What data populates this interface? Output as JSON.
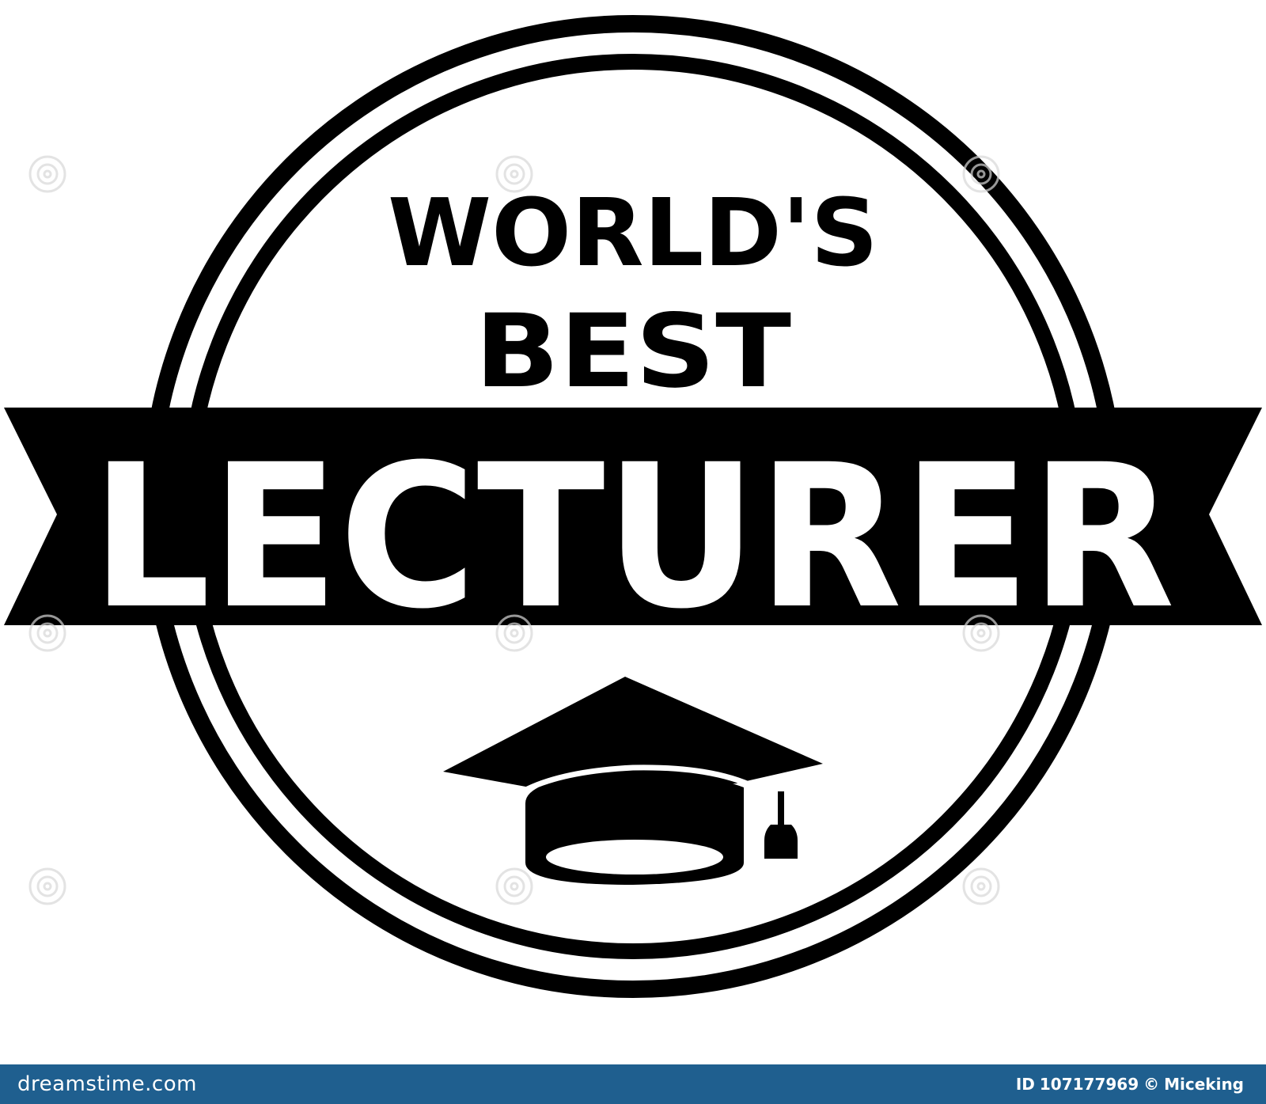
{
  "badge": {
    "line1": "WORLD'S",
    "line2": "BEST",
    "banner_text": "LECTURER",
    "icon": "graduation-cap-icon",
    "ink_color": "#000000",
    "background_color": "#ffffff"
  },
  "watermark": {
    "text": "dreamstime",
    "icon": "swirl-logo-icon"
  },
  "footer": {
    "brand": "dreamstime.com",
    "id_label": "ID",
    "id_value": "107177969",
    "copyright_symbol": "©",
    "author": "Miceking",
    "bar_color": "#1f5f8f"
  }
}
